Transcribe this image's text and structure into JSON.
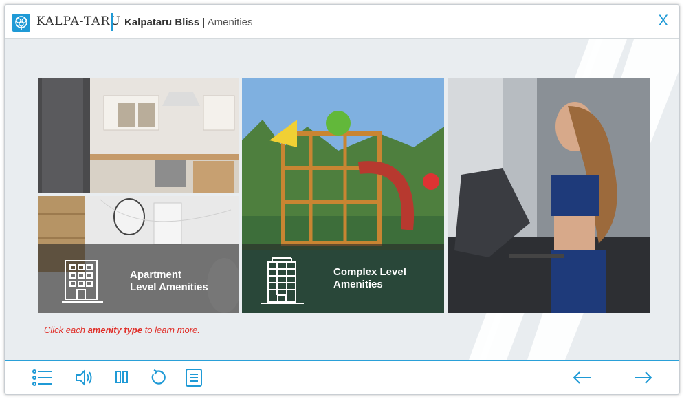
{
  "header": {
    "brand": "KALPA-TARU",
    "project": "Kalpataru Bliss",
    "separator": "|",
    "section": "Amenities",
    "close_label": "X"
  },
  "tiles": {
    "apartment": {
      "line1": "Apartment",
      "line2": "Level Amenities"
    },
    "complex": {
      "line1": "Complex Level",
      "line2": "Amenities"
    }
  },
  "hint": {
    "prefix": "Click each ",
    "emphasis": "amenity type",
    "suffix": " to learn more."
  },
  "footer": {
    "icons": [
      "menu-list-icon",
      "volume-icon",
      "pause-icon",
      "replay-icon",
      "transcript-icon",
      "arrow-left-icon",
      "arrow-right-icon"
    ]
  },
  "colors": {
    "accent": "#1f9ad6",
    "hint": "#e0302a"
  }
}
